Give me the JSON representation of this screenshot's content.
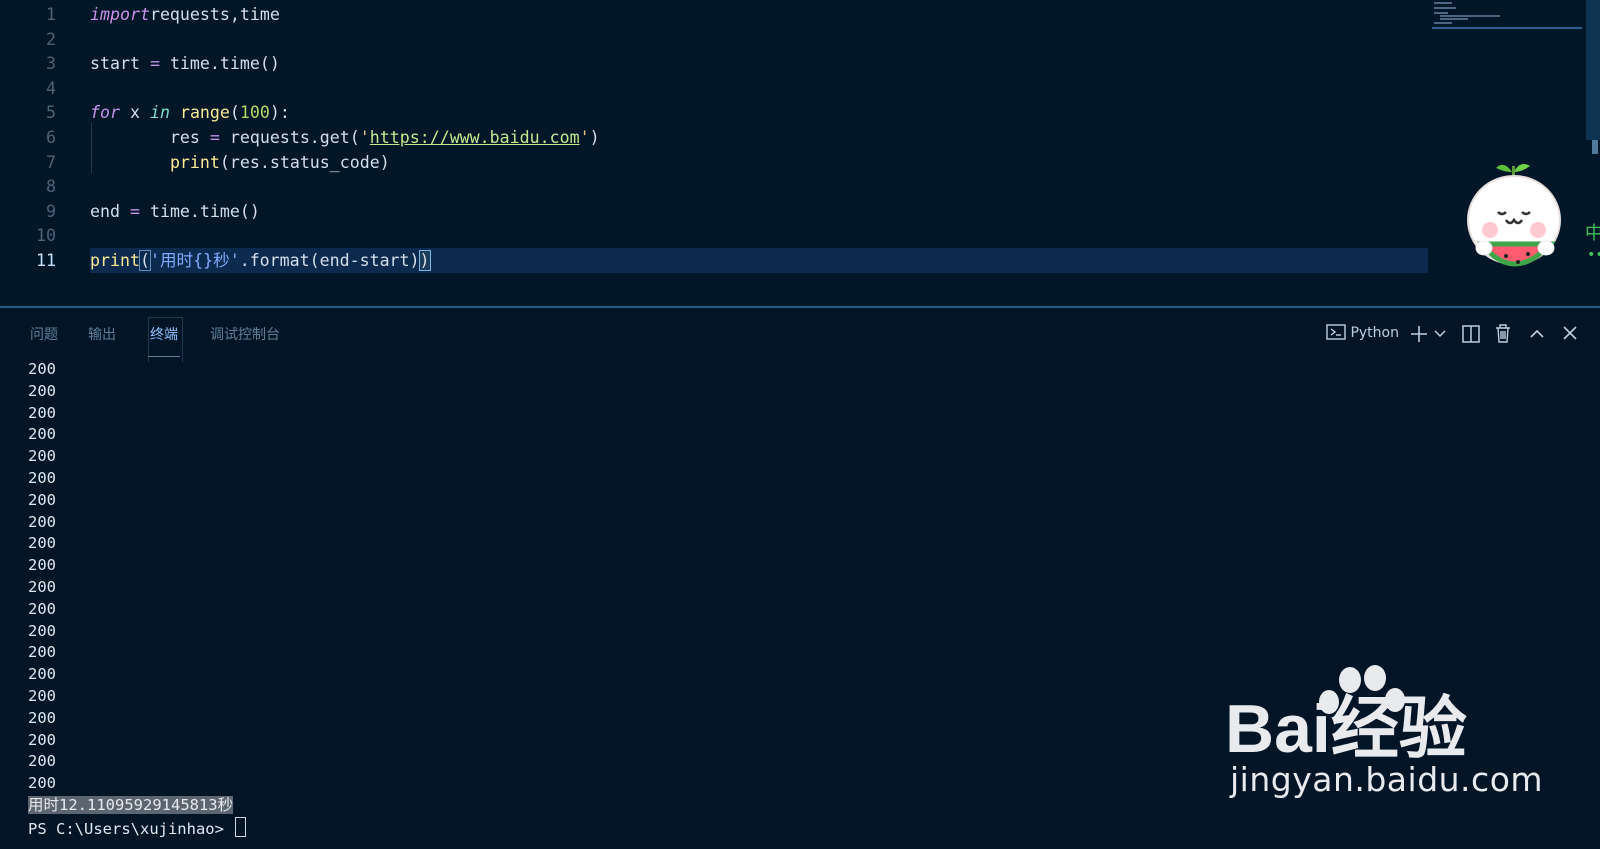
{
  "editor": {
    "lines": [
      {
        "n": "1",
        "tokens": [
          [
            "kw",
            "import"
          ],
          [
            "",
            "requests,time"
          ]
        ]
      },
      {
        "n": "2",
        "tokens": []
      },
      {
        "n": "3",
        "tokens": [
          [
            "",
            "start "
          ],
          [
            "op",
            "="
          ],
          [
            "",
            " time.time()"
          ]
        ]
      },
      {
        "n": "4",
        "tokens": []
      },
      {
        "n": "5",
        "tokens": [
          [
            "kw",
            "for"
          ],
          [
            "",
            " x "
          ],
          [
            "kw2",
            "in"
          ],
          [
            "",
            " "
          ],
          [
            "fn",
            "range"
          ],
          [
            "",
            "("
          ],
          [
            "num2",
            "100"
          ],
          [
            "",
            "):"
          ]
        ]
      },
      {
        "n": "6",
        "tokens": [
          [
            "",
            "        res "
          ],
          [
            "op",
            "="
          ],
          [
            "",
            " requests.get("
          ],
          [
            "str",
            "'"
          ],
          [
            "url",
            "https://www.baidu.com"
          ],
          [
            "str",
            "'"
          ],
          [
            "",
            ")"
          ]
        ]
      },
      {
        "n": "7",
        "tokens": [
          [
            "",
            "        "
          ],
          [
            "fn",
            "print"
          ],
          [
            "",
            "(res.status_code)"
          ]
        ]
      },
      {
        "n": "8",
        "tokens": []
      },
      {
        "n": "9",
        "tokens": [
          [
            "",
            "end "
          ],
          [
            "op",
            "="
          ],
          [
            "",
            " time.time()"
          ]
        ]
      },
      {
        "n": "10",
        "tokens": []
      },
      {
        "n": "11",
        "tokens": [
          [
            "fn",
            "print"
          ],
          [
            "brk",
            "("
          ],
          [
            "cstr",
            "'用时{}秒'"
          ],
          [
            "",
            ".format(end-start)"
          ],
          [
            "brk2",
            ")"
          ]
        ]
      }
    ]
  },
  "panel": {
    "tabs": [
      "问题",
      "输出",
      "终端",
      "调试控制台"
    ],
    "active_tab": "终端",
    "terminal_profile": "Python"
  },
  "terminal": {
    "lines": [
      "200",
      "200",
      "200",
      "200",
      "200",
      "200",
      "200",
      "200",
      "200",
      "200",
      "200",
      "200",
      "200",
      "200",
      "200",
      "200",
      "200",
      "200",
      "200",
      "200"
    ],
    "timing": "用时12.11095929145813秒",
    "prompt": "PS C:\\Users\\xujinhao> "
  },
  "watermark": {
    "brand": "Bai经验",
    "url": "jingyan.baidu.com"
  },
  "side_glyph": "中"
}
